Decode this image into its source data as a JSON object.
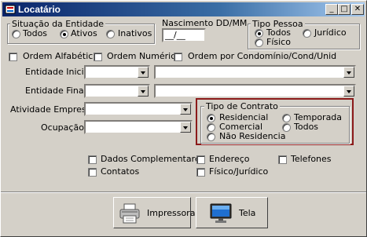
{
  "window": {
    "title": "Locatário"
  },
  "titlebar_buttons": {
    "minimize": "_",
    "maximize": "□",
    "close": "✕"
  },
  "situacao": {
    "title": "Situação da Entidade",
    "options": [
      "Todos",
      "Ativos",
      "Inativos"
    ],
    "selected": "Ativos"
  },
  "nascimento": {
    "label": "Nascimento DD/MM",
    "value": "__/__"
  },
  "tipo_pessoa": {
    "title": "Tipo Pessoa",
    "options": [
      "Todos",
      "Jurídico",
      "Físico"
    ],
    "selected": "Todos"
  },
  "ordem": {
    "alfabetica": "Ordem Alfabética",
    "numerica": "Ordem Numérica",
    "condominio": "Ordem por Condomínio/Cond/Unid"
  },
  "filters": {
    "entidade_inicial": "Entidade Inicial",
    "entidade_final": "Entidade Final",
    "atividade_empresa": "Atividade Empresa",
    "ocupacao": "Ocupação"
  },
  "tipo_contrato": {
    "title": "Tipo de Contrato",
    "options": [
      "Residencial",
      "Temporada",
      "Comercial",
      "Todos",
      "Não Residencia"
    ],
    "selected": "Residencial",
    "highlight_color": "#8b1a1a"
  },
  "extras": {
    "dados_complementares": "Dados Complementares",
    "endereco": "Endereço",
    "telefones": "Telefones",
    "contatos": "Contatos",
    "fisico_juridico": "Físico/Jurídico"
  },
  "actions": {
    "impressora": "Impressora",
    "tela": "Tela"
  }
}
